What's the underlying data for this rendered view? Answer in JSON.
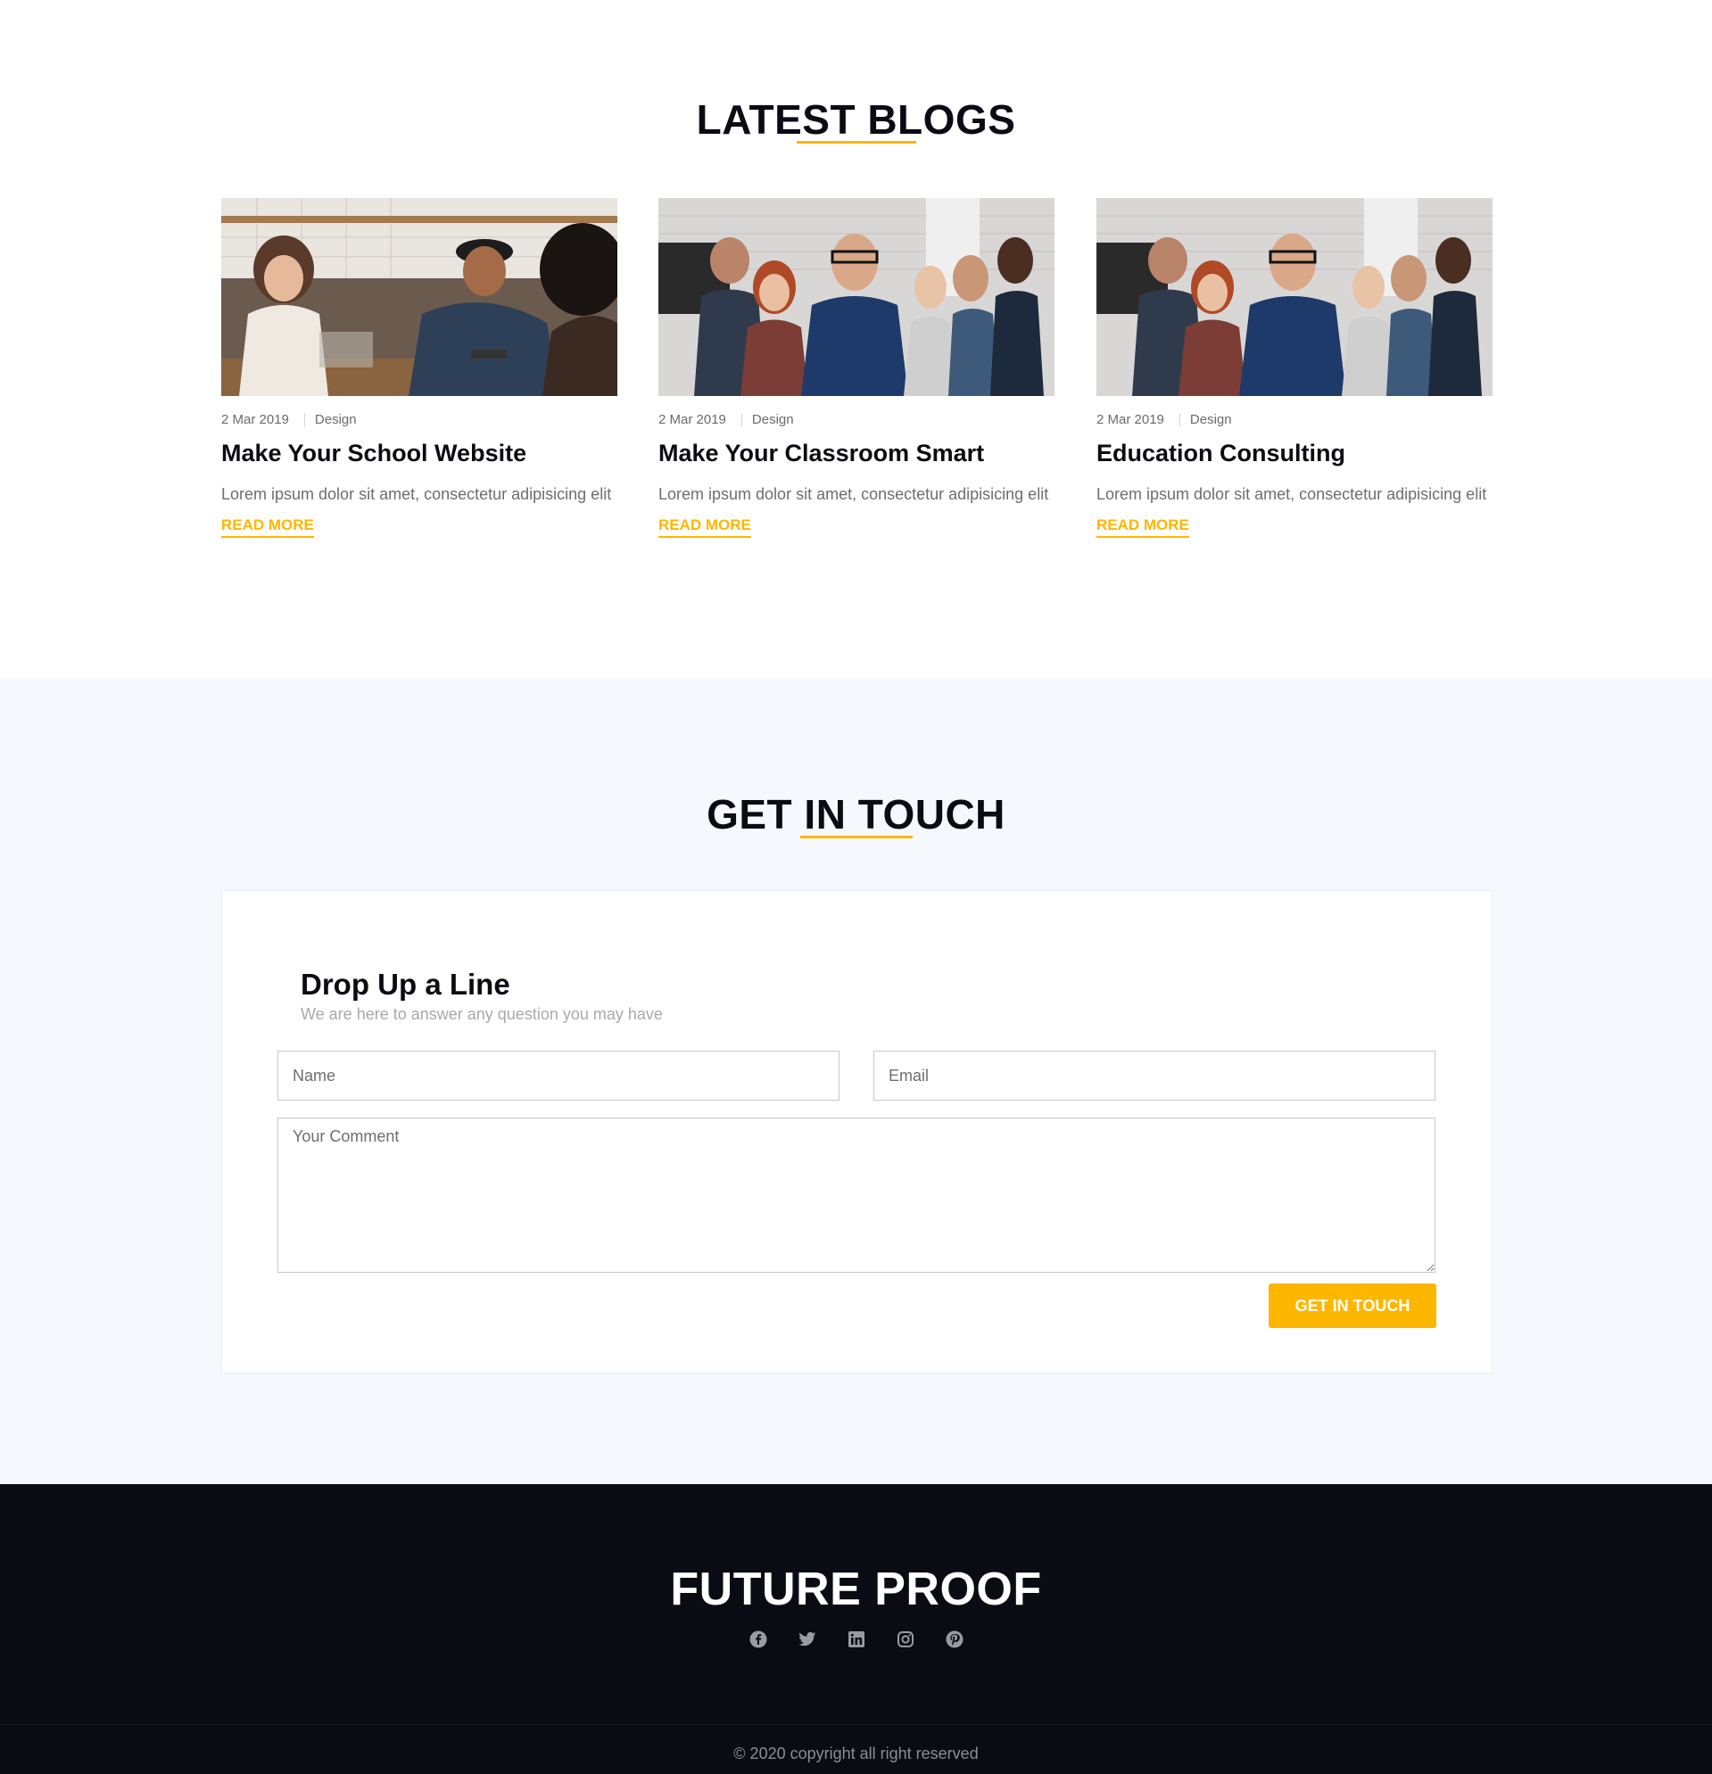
{
  "blogs": {
    "title": "LATEST BLOGS",
    "posts": [
      {
        "date": "2 Mar 2019",
        "category": "Design",
        "title": "Make Your School Website",
        "excerpt": "Lorem ipsum dolor sit amet, consectetur adipisicing elit",
        "link": "READ MORE"
      },
      {
        "date": "2 Mar 2019",
        "category": "Design",
        "title": "Make Your Classroom Smart",
        "excerpt": "Lorem ipsum dolor sit amet, consectetur adipisicing elit",
        "link": "READ MORE"
      },
      {
        "date": "2 Mar 2019",
        "category": "Design",
        "title": "Education Consulting",
        "excerpt": "Lorem ipsum dolor sit amet, consectetur adipisicing elit",
        "link": "READ MORE"
      }
    ]
  },
  "contact": {
    "title": "GET IN TOUCH",
    "form_heading": "Drop Up a Line",
    "form_subheading": "We are here to answer any question you may have",
    "name_placeholder": "Name",
    "email_placeholder": "Email",
    "comment_placeholder": "Your Comment",
    "submit_label": "GET IN TOUCH"
  },
  "footer": {
    "brand": "FUTURE PROOF",
    "social_icons": [
      "facebook-icon",
      "twitter-icon",
      "linkedin-icon",
      "instagram-icon",
      "pinterest-icon"
    ],
    "copyright": "© 2020 copyright all right reserved"
  },
  "colors": {
    "accent": "#fdb700",
    "dark": "#0b0b14",
    "contact_bg": "#f5f8fc"
  }
}
